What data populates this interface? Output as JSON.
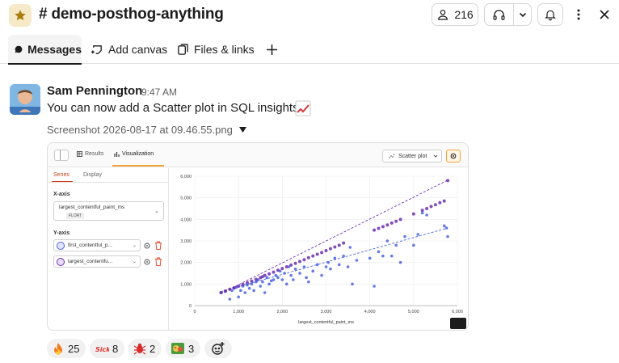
{
  "header": {
    "channel_name": "# demo-posthog-anything",
    "member_count": "216"
  },
  "tabs": [
    {
      "label": "Messages",
      "icon": "message-bubble-icon"
    },
    {
      "label": "Add canvas",
      "icon": "canvas-icon"
    },
    {
      "label": "Files & links",
      "icon": "files-icon"
    }
  ],
  "message": {
    "author": "Sam Pennington",
    "time": "9:47 AM",
    "text": "You can now add a Scatter plot in SQL insights",
    "emoji": "chart-increasing-icon",
    "attachment_name": "Screenshot 2026-08-17 at 09.46.55.png"
  },
  "screenshot": {
    "tab_results": "Results",
    "tab_visualization": "Visualization",
    "chart_type_label": "Scatter plot",
    "panel_tab_series": "Series",
    "panel_tab_display": "Display",
    "x_axis_label": "X-axis",
    "x_axis_value": "largest_contentful_paint_ms",
    "x_axis_type": "FLOAT",
    "y_axis_label": "Y-axis",
    "y_series": [
      {
        "label": "first_contentful_p...",
        "color": "#4a63e0"
      },
      {
        "label": "largest_contentfu...",
        "color": "#6b2fb3"
      }
    ]
  },
  "chart_data": {
    "type": "scatter",
    "xlabel": "largest_contentful_paint_ms",
    "ylabel": "",
    "xlim": [
      0,
      6000
    ],
    "ylim": [
      0,
      6000
    ],
    "xticks": [
      "0",
      "1,000",
      "2,000",
      "3,000",
      "4,000",
      "5,000",
      "6,000"
    ],
    "yticks": [
      "0",
      "1,000",
      "2,000",
      "3,000",
      "4,000",
      "5,000",
      "6,000"
    ],
    "grid": true,
    "series": [
      {
        "color": "#4a63e0",
        "points": [
          [
            600,
            600
          ],
          [
            700,
            650
          ],
          [
            800,
            300
          ],
          [
            850,
            700
          ],
          [
            900,
            800
          ],
          [
            950,
            850
          ],
          [
            1000,
            400
          ],
          [
            1050,
            700
          ],
          [
            1100,
            900
          ],
          [
            1150,
            600
          ],
          [
            1200,
            950
          ],
          [
            1250,
            800
          ],
          [
            1300,
            1000
          ],
          [
            1350,
            700
          ],
          [
            1400,
            1100
          ],
          [
            1450,
            1200
          ],
          [
            1500,
            900
          ],
          [
            1550,
            1100
          ],
          [
            1600,
            600
          ],
          [
            1650,
            1300
          ],
          [
            1700,
            1000
          ],
          [
            1750,
            1150
          ],
          [
            1800,
            1200
          ],
          [
            1850,
            1400
          ],
          [
            1900,
            1300
          ],
          [
            1950,
            1600
          ],
          [
            2000,
            1200
          ],
          [
            2050,
            1500
          ],
          [
            2100,
            1000
          ],
          [
            2150,
            1800
          ],
          [
            2200,
            1400
          ],
          [
            2250,
            1200
          ],
          [
            2300,
            1700
          ],
          [
            2400,
            1500
          ],
          [
            2500,
            1800
          ],
          [
            2550,
            1300
          ],
          [
            2600,
            1100
          ],
          [
            2700,
            1600
          ],
          [
            2800,
            1900
          ],
          [
            2900,
            1400
          ],
          [
            3000,
            1800
          ],
          [
            3050,
            2000
          ],
          [
            3100,
            1700
          ],
          [
            3200,
            2200
          ],
          [
            3300,
            1900
          ],
          [
            3400,
            2300
          ],
          [
            3500,
            1800
          ],
          [
            3550,
            2700
          ],
          [
            3600,
            1000
          ],
          [
            3700,
            2100
          ],
          [
            4000,
            2200
          ],
          [
            4100,
            900
          ],
          [
            4200,
            2500
          ],
          [
            4300,
            2300
          ],
          [
            4400,
            3000
          ],
          [
            4500,
            2300
          ],
          [
            4600,
            2800
          ],
          [
            4700,
            2000
          ],
          [
            4800,
            3200
          ],
          [
            5000,
            2800
          ],
          [
            5100,
            3300
          ],
          [
            5200,
            4300
          ],
          [
            5300,
            4200
          ],
          [
            5700,
            3700
          ],
          [
            5750,
            3600
          ],
          [
            5780,
            3200
          ]
        ],
        "trend": [
          [
            600,
            650
          ],
          [
            5780,
            3600
          ]
        ]
      },
      {
        "color": "#6b2fb3",
        "points": [
          [
            600,
            600
          ],
          [
            700,
            680
          ],
          [
            800,
            760
          ],
          [
            900,
            830
          ],
          [
            1000,
            900
          ],
          [
            1100,
            980
          ],
          [
            1200,
            1060
          ],
          [
            1300,
            1140
          ],
          [
            1400,
            1220
          ],
          [
            1500,
            1300
          ],
          [
            1550,
            1340
          ],
          [
            1600,
            1400
          ],
          [
            1700,
            1470
          ],
          [
            1800,
            1550
          ],
          [
            1900,
            1640
          ],
          [
            2000,
            1720
          ],
          [
            2100,
            1800
          ],
          [
            2200,
            1880
          ],
          [
            2300,
            1960
          ],
          [
            2400,
            2050
          ],
          [
            2500,
            2130
          ],
          [
            2600,
            2220
          ],
          [
            2700,
            2300
          ],
          [
            2800,
            2380
          ],
          [
            2900,
            2460
          ],
          [
            3000,
            2550
          ],
          [
            3100,
            2640
          ],
          [
            3200,
            2720
          ],
          [
            3300,
            2800
          ],
          [
            3400,
            2900
          ],
          [
            4100,
            3500
          ],
          [
            4200,
            3580
          ],
          [
            4300,
            3660
          ],
          [
            4400,
            3740
          ],
          [
            4500,
            3830
          ],
          [
            4600,
            3910
          ],
          [
            4700,
            4000
          ],
          [
            5000,
            4250
          ],
          [
            5200,
            4420
          ],
          [
            5300,
            4500
          ],
          [
            5400,
            4600
          ],
          [
            5500,
            4680
          ],
          [
            5600,
            4770
          ],
          [
            5700,
            4850
          ],
          [
            5780,
            5800
          ]
        ],
        "trend": [
          [
            600,
            560
          ],
          [
            5780,
            5820
          ]
        ]
      }
    ]
  },
  "reactions": [
    {
      "emoji": "fire-icon",
      "count": "25"
    },
    {
      "emoji": "sick-text-icon",
      "count": "8"
    },
    {
      "emoji": "bug-icon",
      "count": "2"
    },
    {
      "emoji": "hedgehog-icon",
      "count": "3"
    }
  ]
}
